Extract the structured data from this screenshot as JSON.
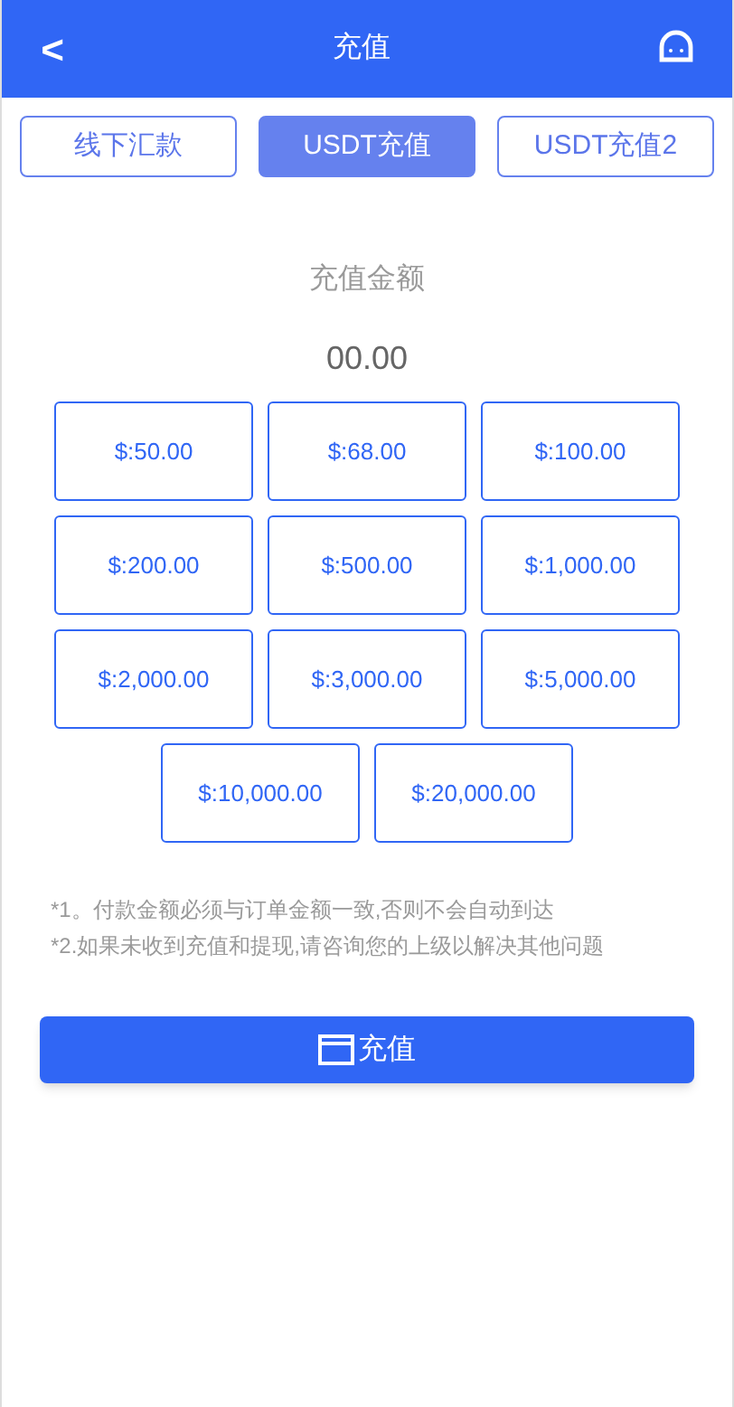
{
  "header": {
    "back": "<",
    "title": "充值"
  },
  "tabs": [
    {
      "label": "线下汇款",
      "selected": false
    },
    {
      "label": "USDT充值",
      "selected": true
    },
    {
      "label": "USDT充值2",
      "selected": false
    }
  ],
  "amount_label": "充值金额",
  "amount_value": "00.00",
  "amounts": [
    "$:50.00",
    "$:68.00",
    "$:100.00",
    "$:200.00",
    "$:500.00",
    "$:1,000.00",
    "$:2,000.00",
    "$:3,000.00",
    "$:5,000.00",
    "$:10,000.00",
    "$:20,000.00"
  ],
  "notes": [
    "*1。付款金额必须与订单金额一致,否则不会自动到达",
    "*2.如果未收到充值和提现,请咨询您的上级以解决其他问题"
  ],
  "submit": "充值"
}
